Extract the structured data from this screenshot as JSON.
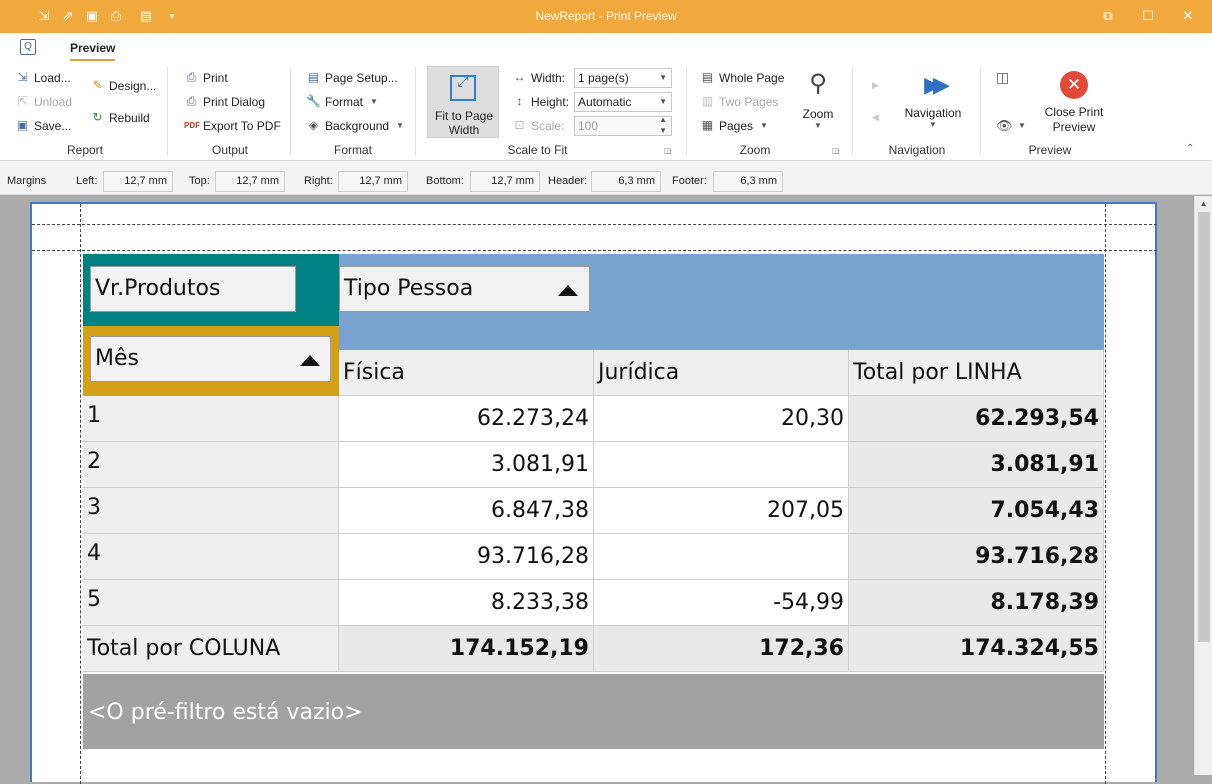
{
  "window": {
    "title": "NewReport - Print Preview",
    "controls": [
      "restore",
      "maximize",
      "close"
    ]
  },
  "ribbon": {
    "tab_icon": "preview-icon",
    "active_tab": "Preview",
    "groups": {
      "report": {
        "label": "Report",
        "load": "Load...",
        "unload": "Unload",
        "save": "Save...",
        "design": "Design...",
        "rebuild": "Rebuild"
      },
      "output": {
        "label": "Output",
        "print": "Print",
        "print_dialog": "Print Dialog",
        "export_pdf": "Export To PDF"
      },
      "format": {
        "label": "Format",
        "page_setup": "Page Setup...",
        "format": "Format",
        "background": "Background"
      },
      "scale_to_fit": {
        "label": "Scale to Fit",
        "fit_to_page_width_line1": "Fit to Page",
        "fit_to_page_width_line2": "Width",
        "width_label": "Width:",
        "width_value": "1 page(s)",
        "height_label": "Height:",
        "height_value": "Automatic",
        "scale_label": "Scale:",
        "scale_value": "100"
      },
      "zoom": {
        "label": "Zoom",
        "whole_page": "Whole Page",
        "two_pages": "Two Pages",
        "pages": "Pages",
        "zoom": "Zoom"
      },
      "navigation": {
        "label": "Navigation",
        "navigation": "Navigation"
      },
      "preview": {
        "label": "Preview",
        "close_line1": "Close Print",
        "close_line2": "Preview"
      }
    }
  },
  "margins": {
    "title": "Margins",
    "left_label": "Left:",
    "left": "12,7 mm",
    "top_label": "Top:",
    "top": "12,7 mm",
    "right_label": "Right:",
    "right": "12,7 mm",
    "bottom_label": "Bottom:",
    "bottom": "12,7 mm",
    "header_label": "Header:",
    "header": "6,3 mm",
    "footer_label": "Footer:",
    "footer": "6,3 mm"
  },
  "pivot": {
    "data_field": "Vr.Produtos",
    "column_field": "Tipo Pessoa",
    "row_field": "Mês",
    "columns": [
      "Física",
      "Jurídica",
      "Total por LINHA"
    ],
    "rows": [
      {
        "label": "1",
        "fisica": "62.273,24",
        "juridica": "20,30",
        "total": "62.293,54"
      },
      {
        "label": "2",
        "fisica": "3.081,91",
        "juridica": "",
        "total": "3.081,91"
      },
      {
        "label": "3",
        "fisica": "6.847,38",
        "juridica": "207,05",
        "total": "7.054,43"
      },
      {
        "label": "4",
        "fisica": "93.716,28",
        "juridica": "",
        "total": "93.716,28"
      },
      {
        "label": "5",
        "fisica": "8.233,38",
        "juridica": "-54,99",
        "total": "8.178,39"
      }
    ],
    "grand_total": {
      "label": "Total por COLUNA",
      "fisica": "174.152,19",
      "juridica": "172,36",
      "total": "174.324,55"
    },
    "prefilter": "<O pré-filtro está vazio>",
    "colors": {
      "data_area": "#008080",
      "row_area": "#d4a017",
      "column_area": "#7ba3d2",
      "prefilter_bar": "#a2a2a2"
    }
  }
}
